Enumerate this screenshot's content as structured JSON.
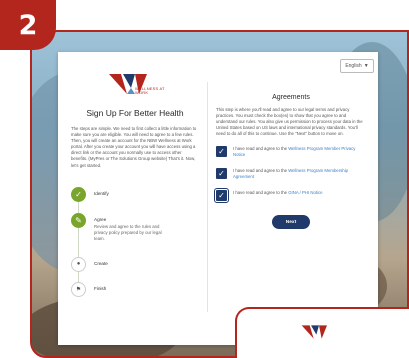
{
  "badge": {
    "number": "2"
  },
  "colors": {
    "brand_red": "#b3261e",
    "brand_navy": "#1f3a6b",
    "step_done_green": "#7aa52b",
    "link_blue": "#3b7fc4"
  },
  "header": {
    "language": "English"
  },
  "left_panel": {
    "logo_text": "WELLNESS AT WORK",
    "title": "Sign Up For Better Health",
    "body": "The steps are simple. We need to first collect a little information to make sure you are eligible. You will need to agree to a few rules. Then, you will create an account for the NBW Wellness at Work portal. After you create your account you will have access using a direct link or the account you normally use to access other benefits. (MyPres or The Solutions Group website) That's it. Now, let's get started.",
    "steps": [
      {
        "icon": "check-icon",
        "label": "Identify",
        "state": "done"
      },
      {
        "icon": "pencil-icon",
        "label": "Agree",
        "description": "Review and agree to the rules and privacy policy prepared by our legal team.",
        "state": "current"
      },
      {
        "icon": "person-icon",
        "label": "Create",
        "state": "todo"
      },
      {
        "icon": "flag-icon",
        "label": "Finish",
        "state": "todo"
      }
    ]
  },
  "right_panel": {
    "title": "Agreements",
    "body": "This step is where you'll read and agree to our legal terms and privacy practices. You must check the box(es) to show that you agree to and understand our rules. You also give us permission to process your data in the United States based on US laws and international privacy standards. You'll need to do all of this to continue. Use the \"Next\" button to move on.",
    "agreements": [
      {
        "prefix": "I have read and agree to the ",
        "link": "Wellness Program Member Privacy Notice",
        "checked": true
      },
      {
        "prefix": "I have read and agree to the ",
        "link": "Wellness Program Membership Agreement",
        "checked": true
      },
      {
        "prefix": "I have read and agree to the ",
        "link": "GINA / PHI Notice",
        "checked": true
      }
    ],
    "next_label": "Next"
  }
}
